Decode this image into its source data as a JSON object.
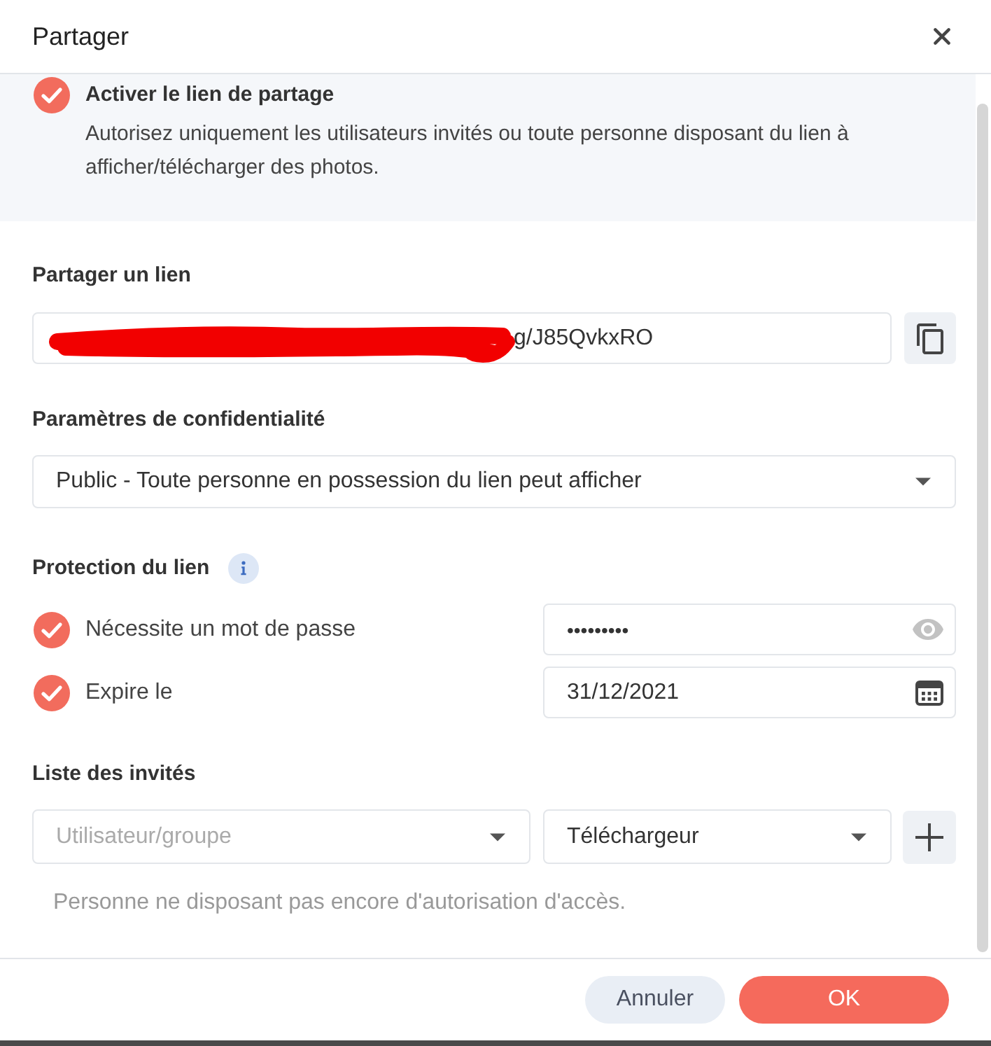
{
  "dialog": {
    "title": "Partager"
  },
  "enable_link": {
    "label": "Activer le lien de partage",
    "description": "Autorisez uniquement les utilisateurs invités ou toute personne disposant du lien à afficher/télécharger des photos.",
    "checked": true
  },
  "share_link": {
    "label": "Partager un lien",
    "value": "g/J85QvkxRO",
    "redacted": true
  },
  "privacy": {
    "label": "Paramètres de confidentialité",
    "value": "Public - Toute personne en possession du lien peut afficher"
  },
  "protection": {
    "label": "Protection du lien",
    "options": [
      {
        "kind": "password",
        "label": "Nécessite un mot de passe",
        "checked": true,
        "value": "•••••••••"
      },
      {
        "kind": "date",
        "label": "Expire le",
        "checked": true,
        "value": "31/12/2021"
      }
    ]
  },
  "guests": {
    "label": "Liste des invités",
    "user_select": {
      "placeholder": "Utilisateur/groupe"
    },
    "role_select": {
      "value": "Téléchargeur"
    },
    "empty_message": "Personne ne disposant pas encore d'autorisation d'accès."
  },
  "buttons": [
    {
      "kind": "secondary",
      "label": "Annuler"
    },
    {
      "kind": "primary",
      "label": "OK"
    }
  ]
}
